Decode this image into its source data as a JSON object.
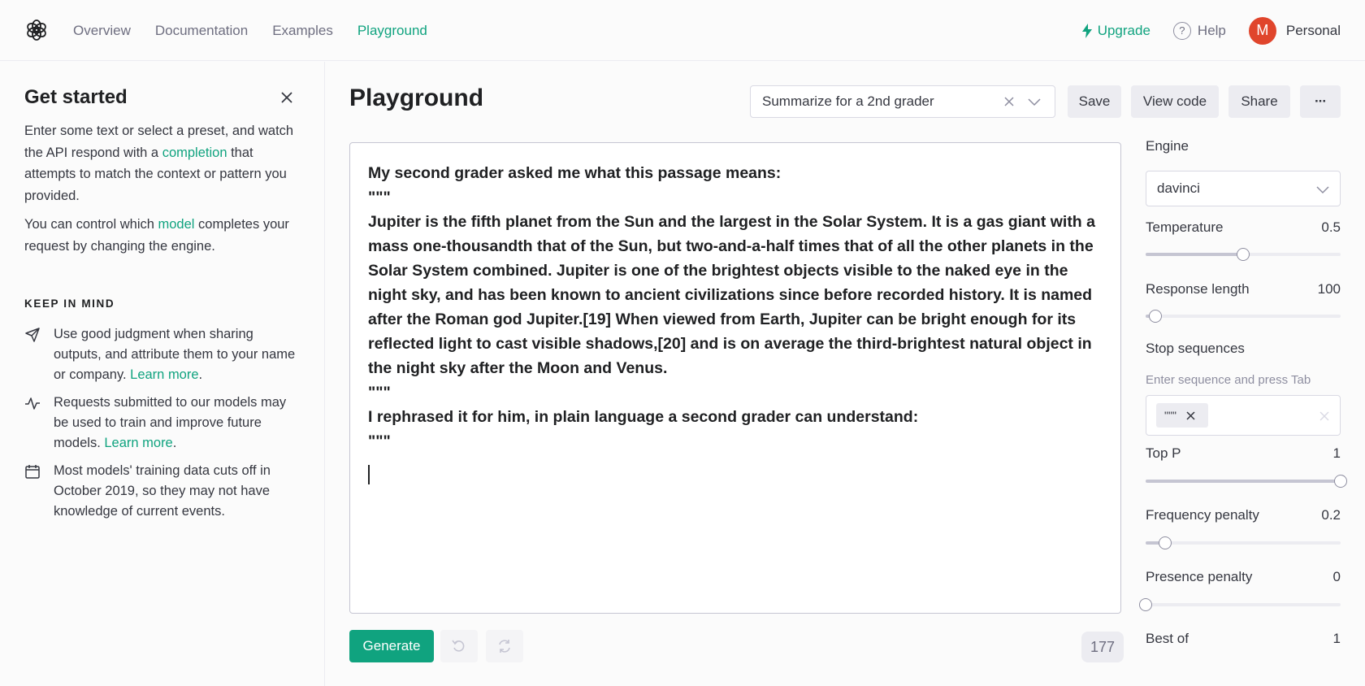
{
  "nav": {
    "links": [
      "Overview",
      "Documentation",
      "Examples",
      "Playground"
    ],
    "active": "Playground",
    "upgrade": "Upgrade",
    "help": "Help",
    "help_glyph": "?",
    "avatar_initial": "M",
    "account": "Personal",
    "accent": "#10a37f",
    "avatar_color": "#e0452c"
  },
  "sidebar": {
    "title": "Get started",
    "intro_1": "Enter some text or select a preset, and watch the API respond with a ",
    "intro_link": "completion",
    "intro_2": " that attempts to match the context or pattern you provided.",
    "model_1": "You can control which ",
    "model_link": "model",
    "model_2": " completes your request by changing the engine.",
    "keep_heading": "KEEP IN MIND",
    "tips": [
      {
        "icon": "send-icon",
        "text": "Use good judgment when sharing outputs, and attribute them to your name or company. ",
        "link": "Learn more",
        "after": "."
      },
      {
        "icon": "activity-icon",
        "text": "Requests submitted to our models may be used to train and improve future models. ",
        "link": "Learn more",
        "after": "."
      },
      {
        "icon": "calendar-icon",
        "text": "Most models' training data cuts off in October 2019, so they may not have knowledge of current events.",
        "link": "",
        "after": ""
      }
    ]
  },
  "main": {
    "title": "Playground",
    "preset": "Summarize for a 2nd grader",
    "save": "Save",
    "view_code": "View code",
    "share": "Share",
    "more": "···",
    "prompt": "My second grader asked me what this passage means:\n\"\"\"\nJupiter is the fifth planet from the Sun and the largest in the Solar System. It is a gas giant with a mass one-thousandth that of the Sun, but two-and-a-half times that of all the other planets in the Solar System combined. Jupiter is one of the brightest objects visible to the naked eye in the night sky, and has been known to ancient civilizations since before recorded history. It is named after the Roman god Jupiter.[19] When viewed from Earth, Jupiter can be bright enough for its reflected light to cast visible shadows,[20] and is on average the third-brightest natural object in the night sky after the Moon and Venus.\n\"\"\"\nI rephrased it for him, in plain language a second grader can understand:\n\"\"\"",
    "generate": "Generate",
    "token_count": "177"
  },
  "settings": {
    "engine_label": "Engine",
    "engine": "davinci",
    "temperature_label": "Temperature",
    "temperature": "0.5",
    "temperature_fraction": 0.5,
    "response_length_label": "Response length",
    "response_length": "100",
    "response_length_fraction": 0.05,
    "stop_label": "Stop sequences",
    "stop_hint": "Enter sequence and press Tab",
    "stop_chip": "\"\"\"",
    "top_p_label": "Top P",
    "top_p": "1",
    "top_p_fraction": 1.0,
    "frequency_label": "Frequency penalty",
    "frequency": "0.2",
    "frequency_fraction": 0.1,
    "presence_label": "Presence penalty",
    "presence": "0",
    "presence_fraction": 0.0,
    "best_of_label": "Best of",
    "best_of": "1"
  }
}
